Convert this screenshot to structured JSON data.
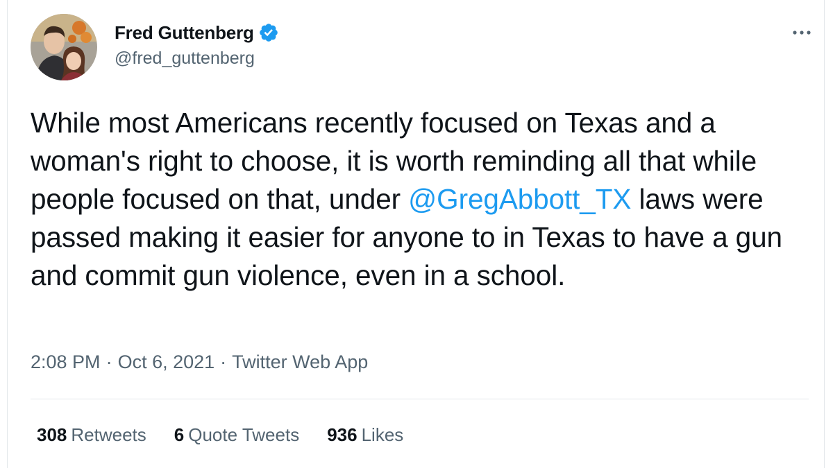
{
  "author": {
    "display_name": "Fred Guttenberg",
    "handle": "@fred_guttenberg",
    "verified_icon": "verified-badge-icon",
    "verified_color": "#1d9bf0"
  },
  "tweet": {
    "text_part1": "While most Americans recently focused on Texas and a woman's right to choose, it is worth reminding all that while people focused on that, under ",
    "mention": "@GregAbbott_TX",
    "text_part2": " laws were passed making it easier for anyone to in Texas to have a gun and commit gun violence, even in a school."
  },
  "meta": {
    "time": "2:08 PM",
    "separator": "·",
    "date": "Oct 6, 2021",
    "source": "Twitter Web App"
  },
  "stats": {
    "retweets_count": "308",
    "retweets_label": "Retweets",
    "quotes_count": "6",
    "quotes_label": "Quote Tweets",
    "likes_count": "936",
    "likes_label": "Likes"
  },
  "colors": {
    "text": "#0f1419",
    "secondary": "#536471",
    "link": "#1d9bf0",
    "border": "#e3e7ea"
  },
  "icons": {
    "more": "more-horizontal-icon"
  }
}
